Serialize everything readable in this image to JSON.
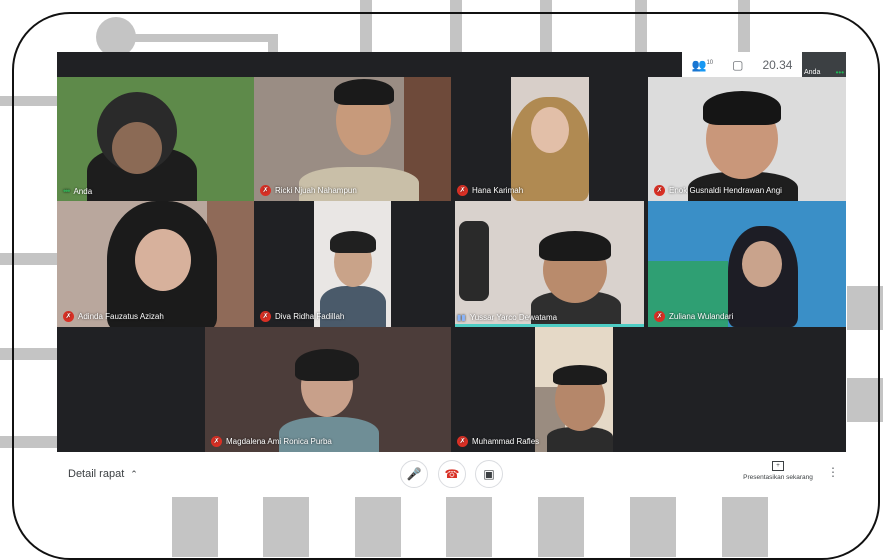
{
  "topbar": {
    "participants_icon": "people-icon",
    "participants_count": "10",
    "chat_icon": "chat-icon",
    "time": "20.34",
    "self_label": "Anda"
  },
  "tiles": [
    {
      "name": "Anda",
      "muted": false
    },
    {
      "name": "Ricki Njuah Nahampun",
      "muted": true
    },
    {
      "name": "Hana Karimah",
      "muted": true
    },
    {
      "name": "Enok Gusnaldi Hendrawan Angi",
      "muted": true
    },
    {
      "name": "Adinda Fauzatus Azizah",
      "muted": true
    },
    {
      "name": "Diva Ridha Fadillah",
      "muted": true
    },
    {
      "name": "Yussar Yarco Dewatama",
      "muted": false
    },
    {
      "name": "Zuliana Wulandari",
      "muted": true
    },
    {
      "name": "Magdalena Ami Ronica Purba",
      "muted": true
    },
    {
      "name": "Muhammad Rafles",
      "muted": true
    }
  ],
  "bottombar": {
    "meeting_details": "Detail rapat",
    "present_label": "Presentasikan sekarang"
  },
  "colors": {
    "mute_red": "#d93025",
    "meet_dark": "#202124",
    "active_outline": "#4ecdc4"
  }
}
